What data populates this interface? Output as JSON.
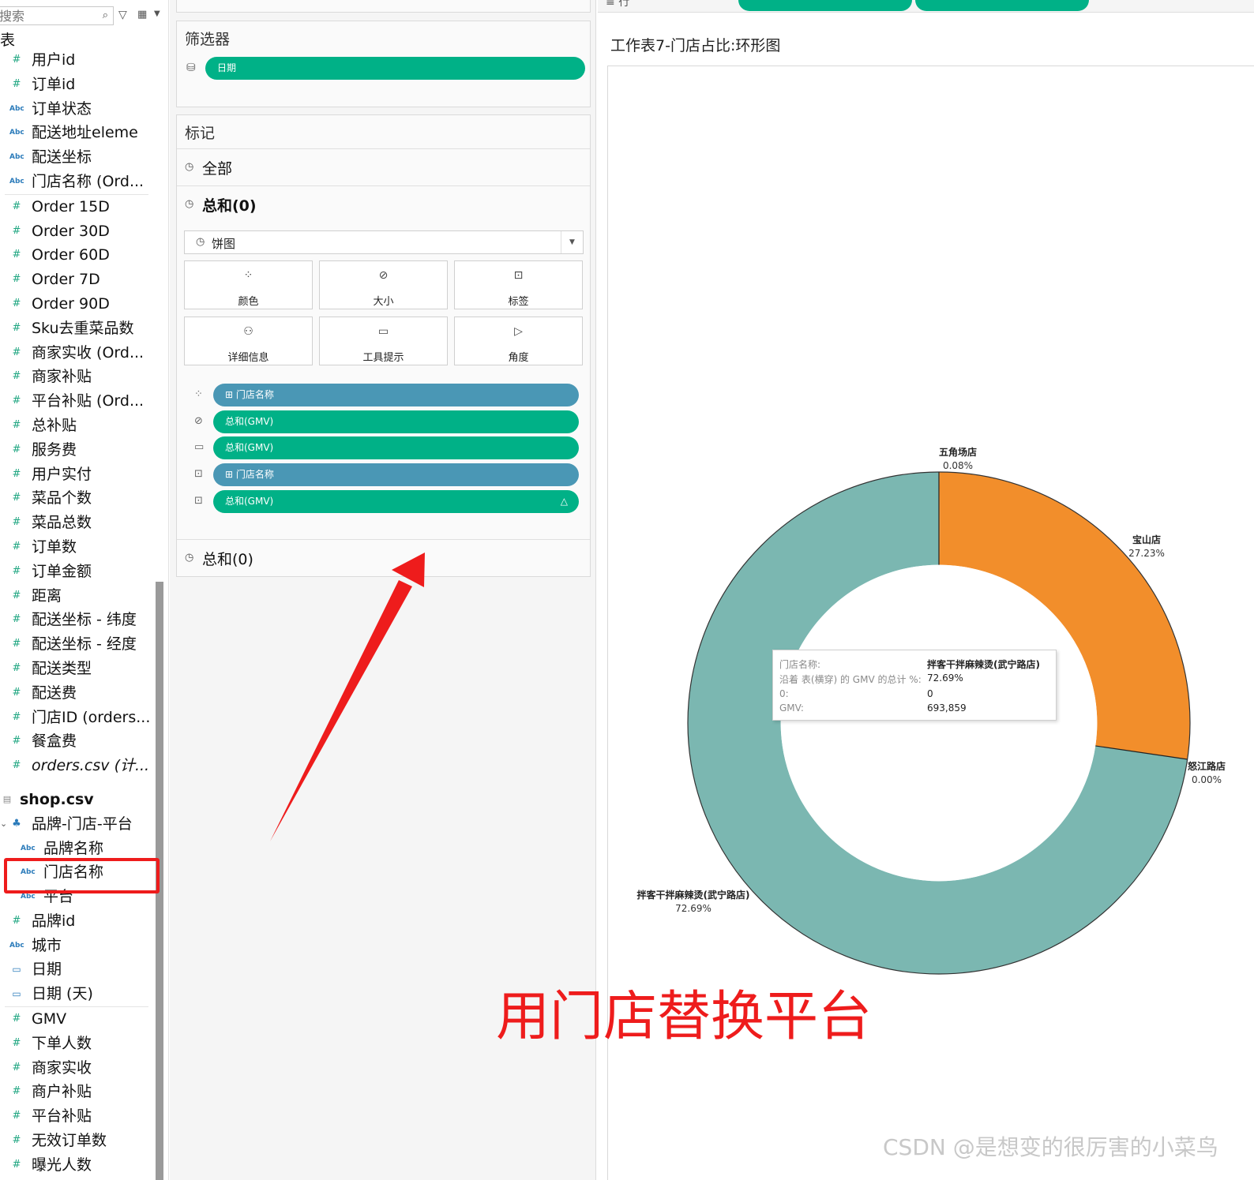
{
  "data_pane": {
    "search_placeholder": "搜索",
    "section_label": "表",
    "fields_orders_dims": [
      {
        "icon": "#",
        "label": "用户id"
      },
      {
        "icon": "#",
        "label": "订单id"
      },
      {
        "icon": "Abc",
        "label": "订单状态"
      },
      {
        "icon": "Abc",
        "label": "配送地址eleme"
      },
      {
        "icon": "Abc",
        "label": "配送坐标"
      },
      {
        "icon": "Abc",
        "label": "门店名称 (Ord..."
      }
    ],
    "fields_orders_measures": [
      {
        "icon": "#",
        "label": "Order 15D"
      },
      {
        "icon": "#",
        "label": "Order 30D"
      },
      {
        "icon": "#",
        "label": "Order 60D"
      },
      {
        "icon": "#",
        "label": "Order 7D"
      },
      {
        "icon": "#",
        "label": "Order 90D"
      },
      {
        "icon": "#",
        "label": "Sku去重菜品数"
      },
      {
        "icon": "#",
        "label": "商家实收 (Ord..."
      },
      {
        "icon": "#",
        "label": "商家补贴"
      },
      {
        "icon": "#",
        "label": "平台补贴 (Ord..."
      },
      {
        "icon": "#",
        "label": "总补贴"
      },
      {
        "icon": "#",
        "label": "服务费"
      },
      {
        "icon": "#",
        "label": "用户实付"
      },
      {
        "icon": "#",
        "label": "菜品个数"
      },
      {
        "icon": "#",
        "label": "菜品总数"
      },
      {
        "icon": "#",
        "label": "订单数"
      },
      {
        "icon": "#",
        "label": "订单金额"
      },
      {
        "icon": "#",
        "label": "距离"
      },
      {
        "icon": "#",
        "label": "配送坐标 - 纬度"
      },
      {
        "icon": "#",
        "label": "配送坐标 - 经度"
      },
      {
        "icon": "#",
        "label": "配送类型"
      },
      {
        "icon": "#",
        "label": "配送费"
      },
      {
        "icon": "#",
        "label": "门店ID (orders..."
      },
      {
        "icon": "#",
        "label": "餐盒费"
      },
      {
        "icon": "#",
        "label": "orders.csv (计..."
      }
    ],
    "shop_table": "shop.csv",
    "hierarchy_label": "品牌-门店-平台",
    "hierarchy_children": [
      {
        "icon": "Abc",
        "label": "品牌名称"
      },
      {
        "icon": "Abc",
        "label": "门店名称"
      },
      {
        "icon": "Abc",
        "label": "平台"
      }
    ],
    "fields_shop_dims": [
      {
        "icon": "#",
        "label": "品牌id"
      },
      {
        "icon": "Abc",
        "label": "城市"
      },
      {
        "icon": "date",
        "label": "日期"
      },
      {
        "icon": "date",
        "label": "日期 (天)"
      }
    ],
    "fields_shop_measures": [
      {
        "icon": "#",
        "label": "GMV"
      },
      {
        "icon": "#",
        "label": "下单人数"
      },
      {
        "icon": "#",
        "label": "商家实收"
      },
      {
        "icon": "#",
        "label": "商户补贴"
      },
      {
        "icon": "#",
        "label": "平台补贴"
      },
      {
        "icon": "#",
        "label": "无效订单数"
      },
      {
        "icon": "#",
        "label": "曝光人数"
      }
    ]
  },
  "filters_card": {
    "title": "筛选器",
    "pill": "日期"
  },
  "marks_card": {
    "title": "标记",
    "all_label": "全部",
    "sum0_label": "总和(0)",
    "mark_type": "饼图",
    "buttons": [
      {
        "icon": "color-icon",
        "label": "颜色"
      },
      {
        "icon": "size-icon",
        "label": "大小"
      },
      {
        "icon": "label-icon",
        "label": "标签"
      },
      {
        "icon": "detail-icon",
        "label": "详细信息"
      },
      {
        "icon": "tooltip-icon",
        "label": "工具提示"
      },
      {
        "icon": "angle-icon",
        "label": "角度"
      }
    ],
    "shelf": [
      {
        "icon": "color-icon",
        "label": "门店名称",
        "color": "blue"
      },
      {
        "icon": "size-icon",
        "label": "总和(GMV)",
        "color": "green"
      },
      {
        "icon": "tooltip-icon",
        "label": "总和(GMV)",
        "color": "green"
      },
      {
        "icon": "label-icon",
        "label": "门店名称",
        "color": "blue"
      },
      {
        "icon": "label-icon",
        "label": "总和(GMV)",
        "color": "green"
      }
    ],
    "second_sum_label": "总和(0)"
  },
  "view": {
    "shelf_label": "行",
    "title": "工作表7-门店占比:环形图"
  },
  "chart_data": {
    "type": "pie",
    "inner_radius_ratio": 0.63,
    "slices": [
      {
        "name": "五角场店",
        "percent_label": "0.08%",
        "value": 0.08,
        "color": "#f28e2b"
      },
      {
        "name": "宝山店",
        "percent_label": "27.23%",
        "value": 27.23,
        "color": "#f28e2b"
      },
      {
        "name": "怒江路店",
        "percent_label": "0.00%",
        "value": 0.0,
        "color": "#7bb7b1"
      },
      {
        "name": "拌客干拌麻辣烫(武宁路店)",
        "percent_label": "72.69%",
        "value": 72.69,
        "color": "#7bb7b1"
      }
    ]
  },
  "tooltip": {
    "rows": [
      {
        "key": "门店名称:",
        "value": "拌客干拌麻辣烫(武宁路店)"
      },
      {
        "key": "沿着 表(横穿) 的 GMV 的总计 %:",
        "value": "72.69%"
      },
      {
        "key": "0:",
        "value": "0"
      },
      {
        "key": "GMV:",
        "value": "693,859"
      }
    ]
  },
  "annotation": "用门店替换平台",
  "watermark": "CSDN @是想变的很厉害的小菜鸟",
  "colors": {
    "pill_green": "#00b187",
    "pill_blue": "#4a97b5",
    "annotation_red": "#ee1c1c"
  }
}
